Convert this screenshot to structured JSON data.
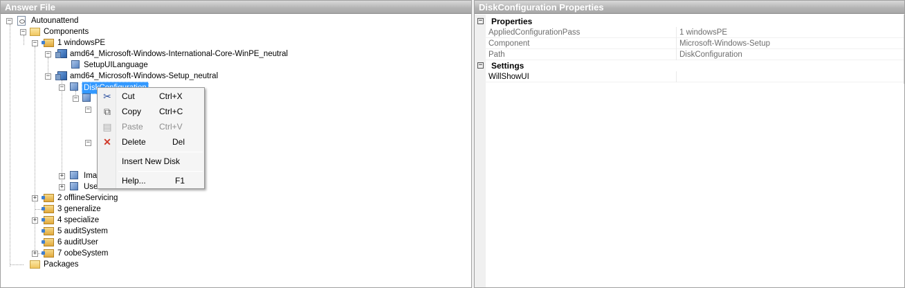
{
  "left_pane": {
    "title": "Answer File"
  },
  "right_pane": {
    "title": "DiskConfiguration Properties"
  },
  "tree": {
    "autounattend": "Autounattend",
    "components": "Components",
    "pass1": "1 windowsPE",
    "intl_core": "amd64_Microsoft-Windows-International-Core-WinPE_neutral",
    "setup_ui_language": "SetupUILanguage",
    "setup_neutral": "amd64_Microsoft-Windows-Setup_neutral",
    "disk_configuration": "DiskConfiguration",
    "image_truncated": "Imag",
    "user_truncated": "User",
    "pass2": "2 offlineServicing",
    "pass3": "3 generalize",
    "pass4": "4 specialize",
    "pass5": "5 auditSystem",
    "pass6": "6 auditUser",
    "pass7": "7 oobeSystem",
    "packages": "Packages"
  },
  "context_menu": {
    "items": [
      {
        "label": "Cut",
        "shortcut": "Ctrl+X",
        "icon": "scissors-icon"
      },
      {
        "label": "Copy",
        "shortcut": "Ctrl+C",
        "icon": "copy-icon"
      },
      {
        "label": "Paste",
        "shortcut": "Ctrl+V",
        "icon": "paste-icon"
      },
      {
        "label": "Delete",
        "shortcut": "Del",
        "icon": "delete-icon"
      },
      {
        "label": "Insert New Disk",
        "shortcut": ""
      },
      {
        "label": "Help...",
        "shortcut": "F1"
      }
    ]
  },
  "properties": {
    "group_properties": "Properties",
    "group_settings": "Settings",
    "rows": [
      {
        "name": "AppliedConfigurationPass",
        "value": "1 windowsPE"
      },
      {
        "name": "Component",
        "value": "Microsoft-Windows-Setup"
      },
      {
        "name": "Path",
        "value": "DiskConfiguration"
      }
    ],
    "settings": [
      {
        "name": "WillShowUI",
        "value": ""
      }
    ]
  },
  "colors": {
    "selection": "#3399ff",
    "header_gradient": "#b3b3b3"
  }
}
